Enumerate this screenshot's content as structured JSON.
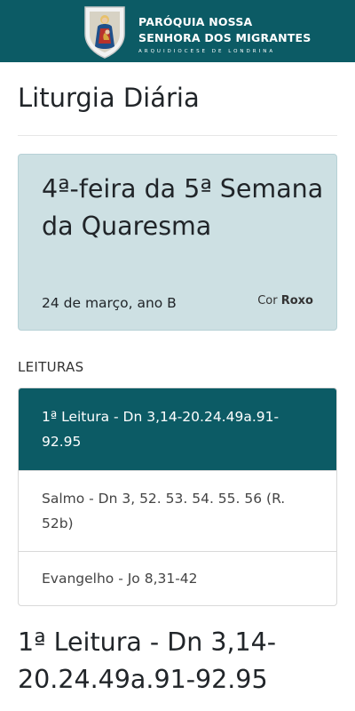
{
  "header": {
    "logo_line1": "PARÓQUIA NOSSA",
    "logo_line2": "SENHORA DOS MIGRANTES",
    "logo_line3": "ARQUIDIOCESE DE LONDRINA",
    "background_color": "#0c5b65"
  },
  "page": {
    "title": "Liturgia Diária"
  },
  "day": {
    "title": "4ª-feira da 5ª Semana da Quaresma",
    "date": "24 de março, ano B",
    "color_label": "Cor",
    "color_value": "Roxo",
    "card_color": "#cde0e3"
  },
  "readings": {
    "section_label": "LEITURAS",
    "items": [
      {
        "label": "1ª Leitura - Dn 3,14-20.24.49a.91-92.95",
        "active": true
      },
      {
        "label": "Salmo - Dn 3, 52. 53. 54. 55. 56 (R. 52b)",
        "active": false
      },
      {
        "label": "Evangelho - Jo 8,31-42",
        "active": false
      }
    ],
    "active_color": "#0c5b65"
  },
  "content": {
    "heading": "1ª Leitura - Dn 3,14-20.24.49a.91-92.95"
  }
}
